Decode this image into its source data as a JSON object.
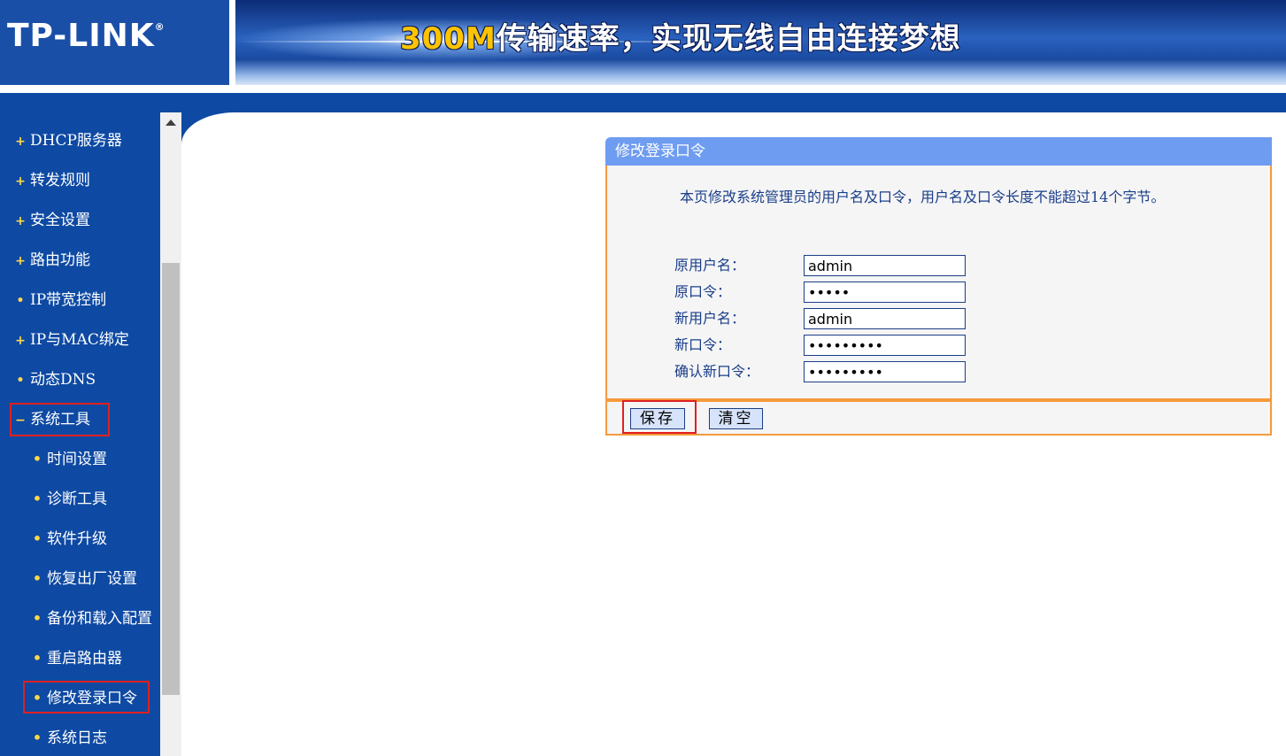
{
  "header": {
    "logo": "TP-LINK",
    "logo_mark": "®",
    "banner_speed": "300M",
    "banner_slogan": "传输速率，实现无线自由连接梦想"
  },
  "sidebar": {
    "items": [
      {
        "label": "DHCP服务器",
        "icon": "plus"
      },
      {
        "label": "转发规则",
        "icon": "plus"
      },
      {
        "label": "安全设置",
        "icon": "plus"
      },
      {
        "label": "路由功能",
        "icon": "plus"
      },
      {
        "label": "IP带宽控制",
        "icon": "dot"
      },
      {
        "label": "IP与MAC绑定",
        "icon": "plus"
      },
      {
        "label": "动态DNS",
        "icon": "dot"
      },
      {
        "label": "系统工具",
        "icon": "minus",
        "expanded": true,
        "highlighted": true
      },
      {
        "label": "时间设置",
        "icon": "dot"
      },
      {
        "label": "诊断工具",
        "icon": "dot"
      },
      {
        "label": "软件升级",
        "icon": "dot"
      },
      {
        "label": "恢复出厂设置",
        "icon": "dot"
      },
      {
        "label": "备份和载入配置",
        "icon": "dot"
      },
      {
        "label": "重启路由器",
        "icon": "dot"
      },
      {
        "label": "修改登录口令",
        "icon": "dot",
        "active": true,
        "highlighted": true
      },
      {
        "label": "系统日志",
        "icon": "dot"
      }
    ]
  },
  "panel": {
    "title": "修改登录口令",
    "description": "本页修改系统管理员的用户名及口令，用户名及口令长度不能超过14个字节。",
    "fields": [
      {
        "label": "原用户名：",
        "value": "admin",
        "type": "text"
      },
      {
        "label": "原口令：",
        "value": "•••••",
        "type": "password"
      },
      {
        "label": "新用户名：",
        "value": "admin",
        "type": "text"
      },
      {
        "label": "新口令：",
        "value": "•••••••••",
        "type": "password"
      },
      {
        "label": "确认新口令：",
        "value": "•••••••••",
        "type": "password"
      }
    ],
    "save_label": "保存",
    "clear_label": "清空"
  },
  "colors": {
    "header_blue": "#1a4fa8",
    "sidebar_blue": "#0e4aa3",
    "panel_title_blue": "#6e9cf0",
    "panel_border_orange": "#f59a3c",
    "highlight_red": "#e02020",
    "bullet_yellow": "#ffd84a"
  }
}
